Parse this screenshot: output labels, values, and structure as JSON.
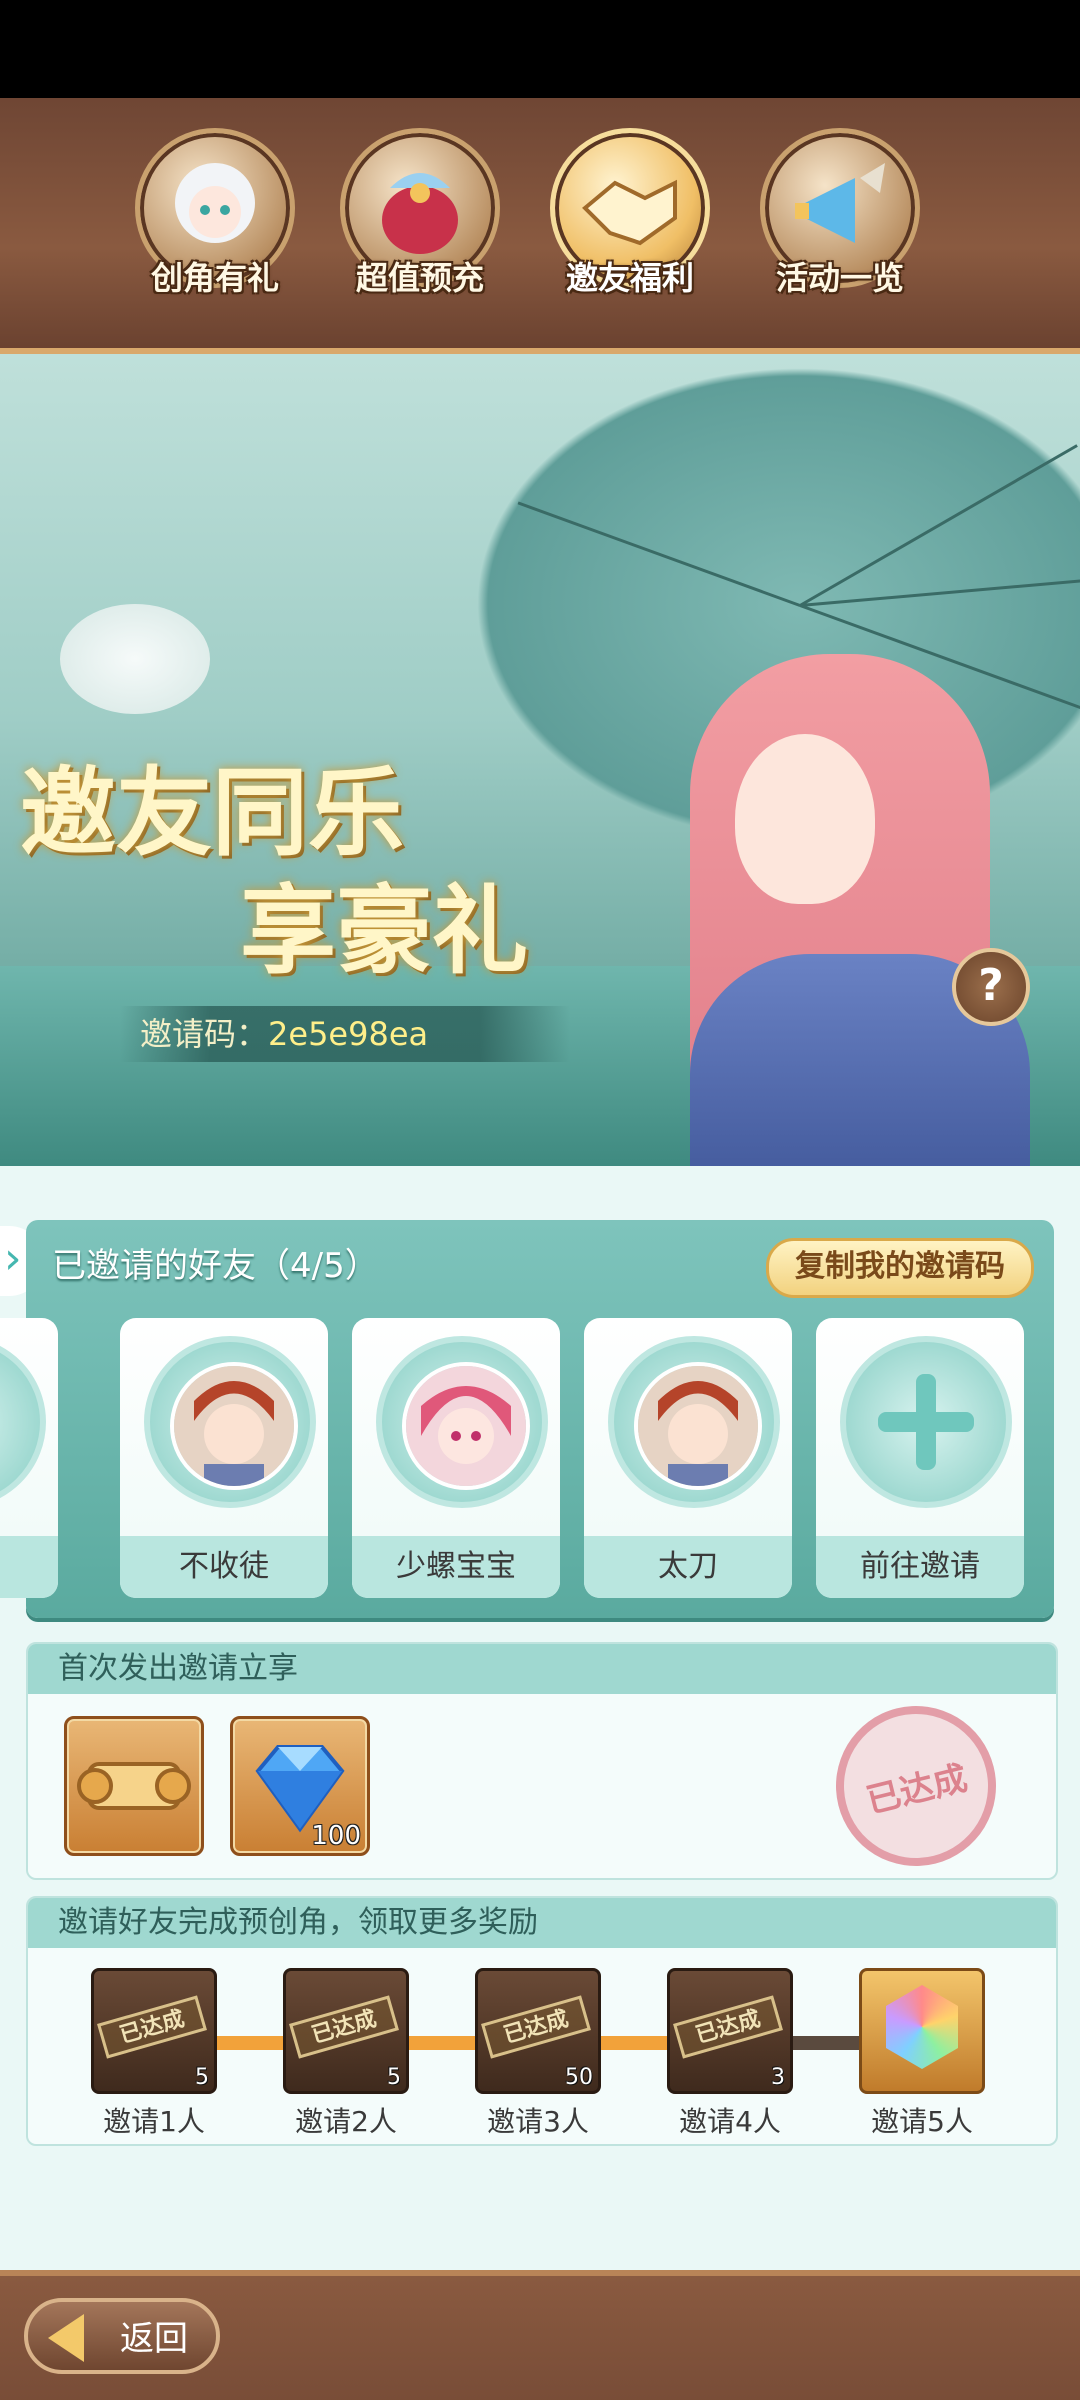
{
  "tabs": [
    {
      "label": "创角有礼",
      "icon": "girl-avatar-icon",
      "selected": false
    },
    {
      "label": "超值预充",
      "icon": "gift-bag-icon",
      "selected": false
    },
    {
      "label": "邀友福利",
      "icon": "handshake-icon",
      "selected": true
    },
    {
      "label": "活动一览",
      "icon": "megaphone-icon",
      "selected": false
    }
  ],
  "banner": {
    "title_line1": "邀友同乐",
    "title_line2": "享豪礼",
    "invite_code_label": "邀请码：",
    "invite_code_value": "2e5e98ea",
    "help": "?"
  },
  "friends": {
    "title": "已邀请的好友（4/5）",
    "copy_button": "复制我的邀请码",
    "cards": [
      {
        "name": "不收徒",
        "avatar": "male-hero-avatar"
      },
      {
        "name": "少螺宝宝",
        "avatar": "pink-hair-girl-avatar"
      },
      {
        "name": "太刀",
        "avatar": "male-hero-avatar"
      },
      {
        "name": "前往邀请",
        "avatar": "plus-icon"
      }
    ]
  },
  "first_invite": {
    "header": "首次发出邀请立享",
    "items": [
      {
        "icon": "golden-scroll-icon",
        "count": ""
      },
      {
        "icon": "blue-diamond-icon",
        "count": "100"
      }
    ],
    "stamp": "已达成"
  },
  "tiers": {
    "header": "邀请好友完成预创角，领取更多奖励",
    "items": [
      {
        "label": "邀请1人",
        "count": "5",
        "claimed": "已达成"
      },
      {
        "label": "邀请2人",
        "count": "5",
        "claimed": "已达成"
      },
      {
        "label": "邀请3人",
        "count": "50",
        "claimed": "已达成"
      },
      {
        "label": "邀请4人",
        "count": "3",
        "claimed": "已达成"
      },
      {
        "label": "邀请5人",
        "count": "",
        "claimed": ""
      }
    ]
  },
  "footer": {
    "back": "返回"
  },
  "colors": {
    "accent": "#5aaa9f",
    "brown": "#8a5a40",
    "gold": "#f2d27f"
  }
}
